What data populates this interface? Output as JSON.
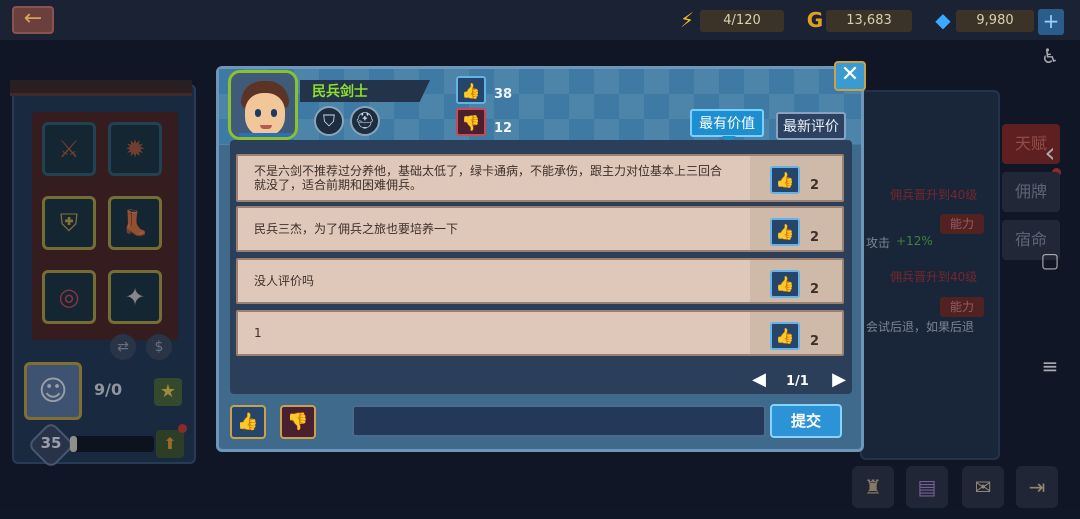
{
  "topbar": {
    "back_icon": "←",
    "energy": {
      "icon": "⚡",
      "value": "4/120"
    },
    "gold": {
      "icon": "G",
      "value": "13,683"
    },
    "gems": {
      "icon": "◆",
      "value": "9,980"
    },
    "add_icon": "+"
  },
  "left": {
    "hero_count": "9/0",
    "level": "35",
    "xp_progress": 0.08,
    "slot_icons": [
      "⚔",
      "✹",
      "⛨",
      "👢",
      "◎",
      "✦"
    ]
  },
  "right": {
    "tabs": [
      "天赋",
      "佣牌",
      "宿命"
    ],
    "texts": [
      "佣兵晋升到40级",
      "能力",
      "攻击",
      "+12%",
      "佣兵晋升到40级",
      "能力",
      "会试后退，如果后退"
    ]
  },
  "modal": {
    "hero_name": "民兵剑士",
    "class_icons": [
      "⛉",
      "⛑"
    ],
    "likes": "38",
    "dislikes": "12",
    "tab_best": "最有价值",
    "tab_newest": "最新评价",
    "close_icon": "✕",
    "reviews": [
      {
        "text": "不是六剑不推荐过分养他，基础太低了，绿卡通病，不能承伤，跟主力对位基本上三回合就没了，适合前期和困难佣兵。",
        "likes": "2"
      },
      {
        "text": "民兵三杰，为了佣兵之旅也要培养一下",
        "likes": "2"
      },
      {
        "text": "没人评价吗",
        "likes": "2"
      },
      {
        "text": "1",
        "likes": "2"
      }
    ],
    "page": "1/1",
    "comment_value": "",
    "comment_placeholder": "",
    "submit": "提交"
  },
  "icons": {
    "thumb_up": "👍",
    "thumb_down": "👎",
    "prev": "◀",
    "next": "▶"
  },
  "system_nav": {
    "accessibility": "♿",
    "back": "‹",
    "home": "▢",
    "menu": "≡"
  }
}
